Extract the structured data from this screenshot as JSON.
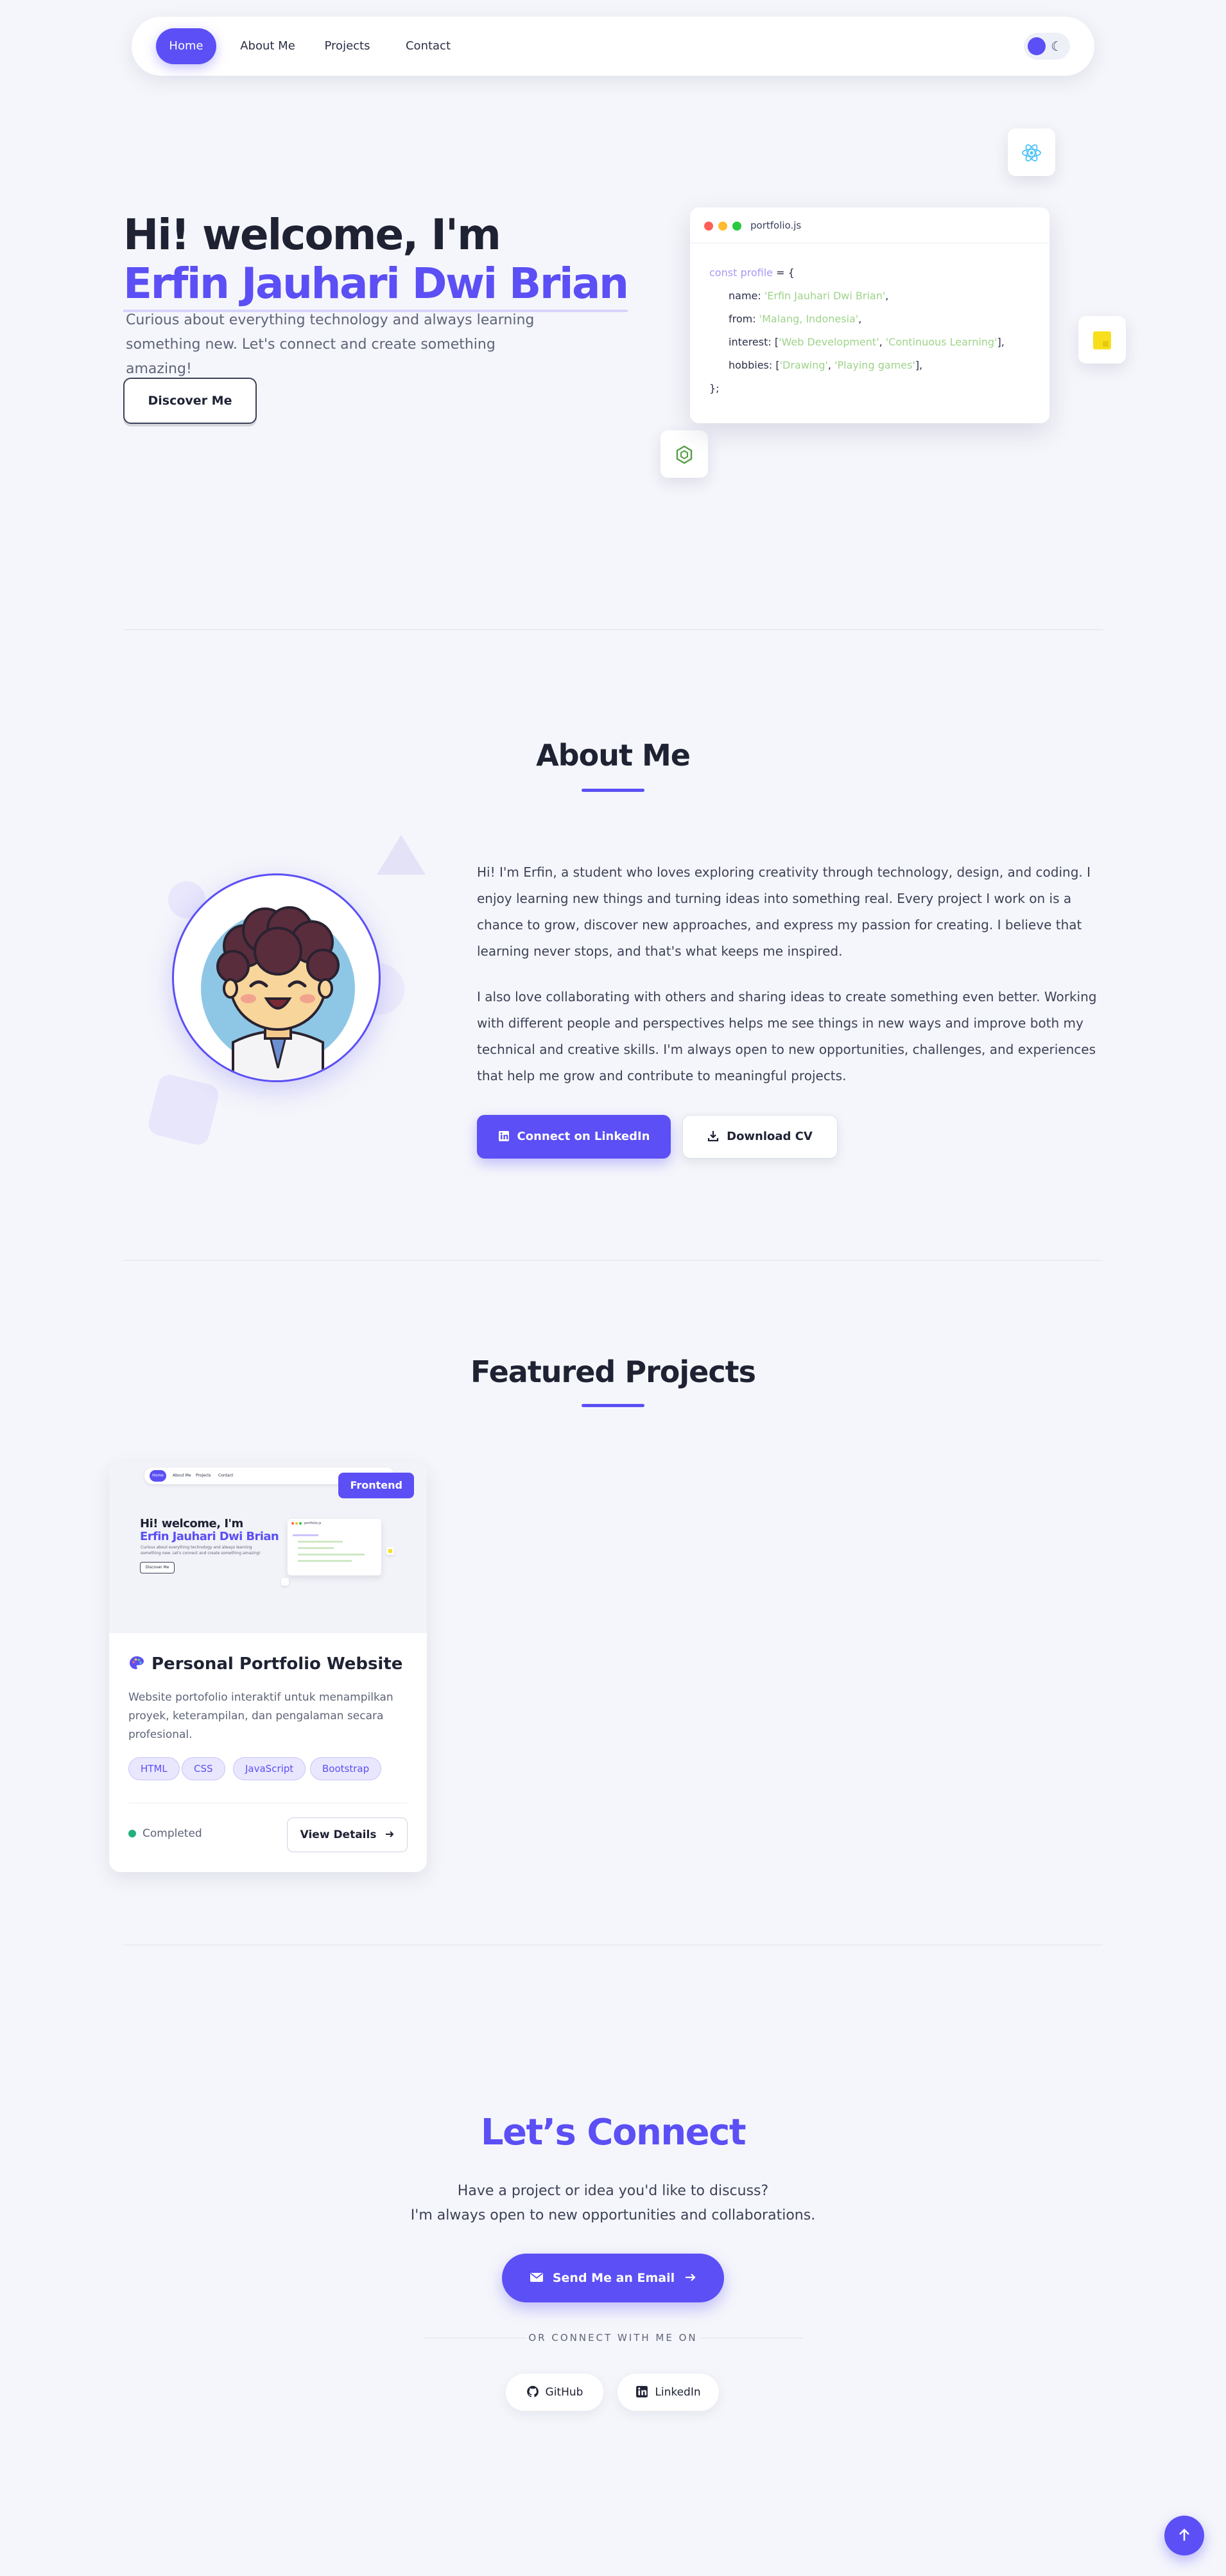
{
  "nav": {
    "items": [
      {
        "label": "Home",
        "active": true
      },
      {
        "label": "About Me",
        "active": false
      },
      {
        "label": "Projects",
        "active": false
      },
      {
        "label": "Contact",
        "active": false
      }
    ],
    "theme_toggle_icon": "moon-icon"
  },
  "hero": {
    "greeting": "Hi! welcome, I'm",
    "name": "Erfin Jauhari Dwi Brian",
    "description_line1": "Curious about everything technology and always learning",
    "description_line2": "something new. Let's connect and create something amazing!",
    "cta_label": "Discover Me",
    "code": {
      "filename": "portfolio.js",
      "decl_kw": "const",
      "decl_name": "profile",
      "decl_eq": " = {",
      "name_key": "name: ",
      "name_val": "'Erfin Jauhari Dwi Brian'",
      "from_key": "from: ",
      "from_val": "'Malang, Indonesia'",
      "interest_key": "interest: [",
      "interest_val1": "'Web Development'",
      "interest_sep": ", ",
      "interest_val2": "'Continuous Learning'",
      "interest_end": "],",
      "hobbies_key": "hobbies: [",
      "hobbies_val1": "'Drawing'",
      "hobbies_sep": ", ",
      "hobbies_val2": "'Playing games'",
      "hobbies_end": "],",
      "close": "};",
      "comma": ","
    },
    "floating_icons": [
      "react-icon",
      "js-icon",
      "node-icon"
    ]
  },
  "about": {
    "title": "About Me",
    "paragraph1": "Hi! I'm Erfin, a student who loves exploring creativity through technology, design, and coding. I enjoy learning new things and turning ideas into something real. Every project I work on is a chance to grow, discover new approaches, and express my passion for creating. I believe that learning never stops, and that's what keeps me inspired.",
    "paragraph2": "I also love collaborating with others and sharing ideas to create something even better. Working with different people and perspectives helps me see things in new ways and improve both my technical and creative skills. I'm always open to new opportunities, challenges, and experiences that help me grow and contribute to meaningful projects.",
    "linkedin_label": "Connect on LinkedIn",
    "cv_label": "Download CV"
  },
  "projects": {
    "title": "Featured Projects",
    "cards": [
      {
        "badge": "Frontend",
        "title": "Personal Portfolio Website",
        "description": "Website portofolio interaktif untuk menampilkan proyek, keterampilan, dan pengalaman secara profesional.",
        "tags": [
          "HTML",
          "CSS",
          "JavaScript",
          "Bootstrap"
        ],
        "status": "Completed",
        "details_label": "View Details",
        "thumb": {
          "nav": [
            "Home",
            "About Me",
            "Projects",
            "Contact"
          ],
          "greeting": "Hi! welcome, I'm",
          "name": "Erfin Jauhari Dwi Brian",
          "line1": "Curious about everything technology and always learning",
          "line2": "something new. Let's connect and create something amazing!",
          "cta": "Discover Me",
          "filename": "portfolio.js"
        }
      }
    ]
  },
  "connect": {
    "title": "Let’s Connect",
    "line1": "Have a project or idea you'd like to discuss?",
    "line2": "I'm always open to new opportunities and collaborations.",
    "email_label": "Send Me an Email",
    "or_text": "OR CONNECT WITH ME ON",
    "github_label": "GitHub",
    "linkedin_label": "LinkedIn"
  },
  "colors": {
    "accent": "#5b4ff5",
    "background": "#f5f6fb",
    "text": "#1e2233",
    "string": "#9ed38a",
    "keyword": "#a59bf5",
    "status_green": "#22b07d"
  }
}
